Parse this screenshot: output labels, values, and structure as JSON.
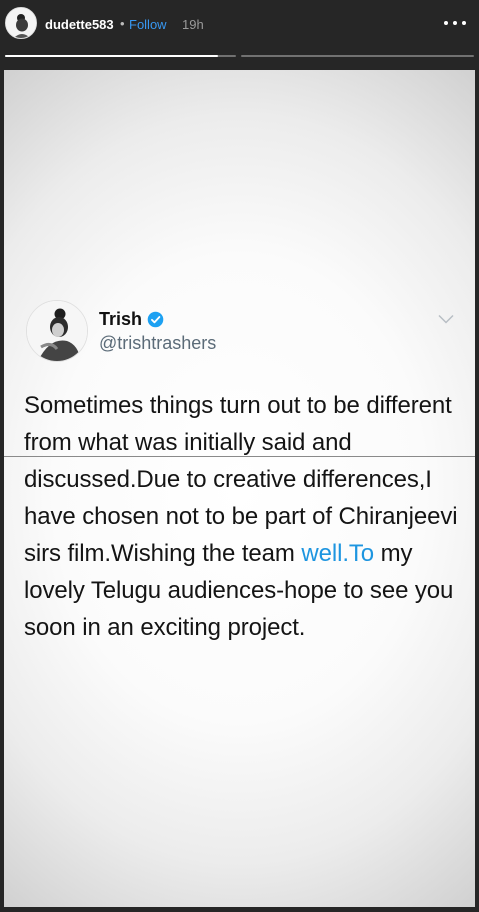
{
  "header": {
    "username": "dudette583",
    "separator": "•",
    "follow_label": "Follow",
    "time": "19h",
    "more_icon": "more-horizontal-icon"
  },
  "progress": {
    "segments": 2,
    "current_segment_fill": 0.92
  },
  "tweet": {
    "name": "Trish",
    "handle": "@trishtrashers",
    "verified_icon": "verified-badge-icon",
    "text_before_link": "Sometimes things turn out to be different from what was initially said and discussed.Due to creative differences,I have chosen not to be part of Chiranjeevi sirs film.Wishing the team ",
    "link_text": "well.To",
    "text_after_link": " my lovely Telugu audiences-hope to see you soon in an exciting project.",
    "link_color": "#1d95e0"
  },
  "colors": {
    "follow": "#3897f0",
    "verified": "#1da1f2"
  }
}
